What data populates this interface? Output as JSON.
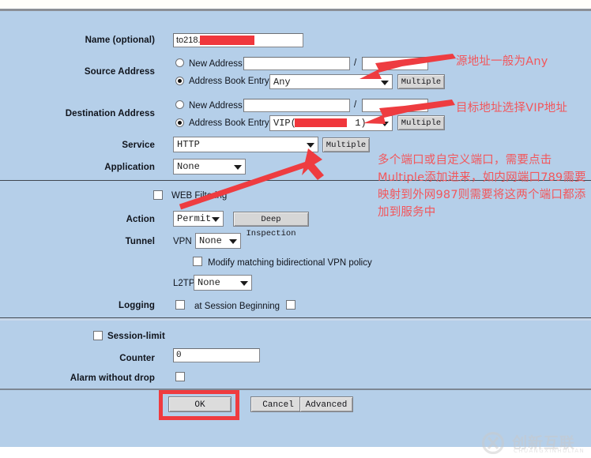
{
  "form": {
    "name_row": {
      "label": "Name (optional)",
      "value": "to218.",
      "redacted": true
    },
    "source_address": {
      "label": "Source Address",
      "new_address_label": "New Address",
      "new_address_value": "",
      "netmask_value": "",
      "separator": "/",
      "book_entry_label": "Address Book Entry",
      "book_entry_value": "Any",
      "multiple_label": "Multiple",
      "selected": "address-book-entry"
    },
    "destination_address": {
      "label": "Destination Address",
      "new_address_label": "New Address",
      "new_address_value": "",
      "netmask_value": "",
      "separator": "/",
      "book_entry_label": "Address Book Entry",
      "book_entry_value": "VIP(21",
      "book_entry_value_tail": "1)",
      "multiple_label": "Multiple",
      "selected": "address-book-entry"
    },
    "service": {
      "label": "Service",
      "value": "HTTP",
      "multiple_label": "Multiple"
    },
    "application": {
      "label": "Application",
      "value": "None"
    },
    "web_filtering": {
      "label": "WEB Filtering",
      "checked": false
    },
    "action": {
      "label": "Action",
      "value": "Permit",
      "deep_inspection_label": "Deep Inspection"
    },
    "tunnel": {
      "label": "Tunnel",
      "vpn_label": "VPN",
      "vpn_value": "None"
    },
    "modify_bidirectional": {
      "label": "Modify matching bidirectional VPN policy",
      "checked": false
    },
    "l2tp": {
      "label": "L2TP",
      "value": "None"
    },
    "logging": {
      "label": "Logging",
      "checked": false,
      "session_beginning_label": "at Session Beginning",
      "session_beginning_checked": false
    },
    "session_limit": {
      "label": "Session-limit",
      "checked": false
    },
    "counter": {
      "label": "Counter",
      "value": "0"
    },
    "alarm_without_drop": {
      "label": "Alarm without drop",
      "checked": false
    }
  },
  "buttons": {
    "ok": "OK",
    "cancel": "Cancel",
    "advanced": "Advanced"
  },
  "annotations": [
    {
      "id": "source-note",
      "text": "源地址一般为Any"
    },
    {
      "id": "destination-note",
      "text": "目标地址选择VIP地址"
    },
    {
      "id": "service-note",
      "text": "多个端口或自定义端口，需要点击Multiple添加进来，如内网端口789需要映射到外网987则需要将这两个端口都添加到服务中"
    }
  ],
  "watermark": {
    "primary": "创新互联",
    "secondary": "CHUANGXINHULIAN"
  },
  "colors": {
    "panel_background": "#b5cfe9",
    "annotation_red": "#f2575c",
    "highlight_red": "#ef3b3f",
    "redaction_red": "#f0373c"
  }
}
